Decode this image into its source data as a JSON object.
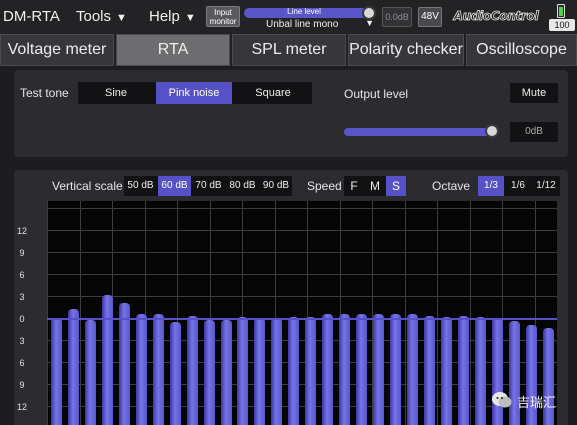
{
  "menubar": {
    "app_name": "DM-RTA",
    "tools_label": "Tools",
    "help_label": "Help",
    "caret": "▼",
    "input_monitor_label": "Input monitor",
    "line_level_label": "Line level",
    "line_level_fraction": 1.0,
    "input_mode_value": "Unbal line mono",
    "input_gain_readout": "0.0dB",
    "phantom_label": "48V",
    "brand": "AudioControl",
    "battery_readout": "100",
    "battery_color": "#4fd34f"
  },
  "tabs": [
    {
      "label": "Voltage meter",
      "active": false
    },
    {
      "label": "RTA",
      "active": true
    },
    {
      "label": "SPL meter",
      "active": false
    },
    {
      "label": "Polarity checker",
      "active": false
    },
    {
      "label": "Oscilloscope",
      "active": false
    }
  ],
  "test_tone": {
    "label": "Test tone",
    "options": [
      "Sine",
      "Pink noise",
      "Square"
    ],
    "selected": "Pink noise",
    "output_level_label": "Output level",
    "mute_label": "Mute",
    "output_level_fraction": 1.0,
    "output_readout": "0dB"
  },
  "rta": {
    "vertical_scale_label": "Vertical scale",
    "vertical_scale_options": [
      "50 dB",
      "60 dB",
      "70 dB",
      "80 dB",
      "90 dB"
    ],
    "vertical_scale_selected": "60 dB",
    "speed_label": "Speed",
    "speed_options": [
      "F",
      "M",
      "S"
    ],
    "speed_selected": "S",
    "octave_label": "Octave",
    "octave_options": [
      "1/3",
      "1/6",
      "1/12"
    ],
    "octave_selected": "1/3",
    "y_ticks": [
      "12",
      "9",
      "6",
      "3",
      "0",
      "3",
      "6",
      "9",
      "12"
    ],
    "bar_levels_db": [
      0.0,
      1.2,
      -0.3,
      3.1,
      2.1,
      0.5,
      0.5,
      -0.5,
      0.3,
      -0.3,
      -0.3,
      0.2,
      0.0,
      0.0,
      0.2,
      0.1,
      0.6,
      0.5,
      0.6,
      0.6,
      0.6,
      0.5,
      0.3,
      0.2,
      0.3,
      0.2,
      0.0,
      -0.4,
      -1.0,
      -1.4
    ],
    "accent_color": "#5651c6"
  },
  "watermark": {
    "text": "吉瑞汇"
  }
}
